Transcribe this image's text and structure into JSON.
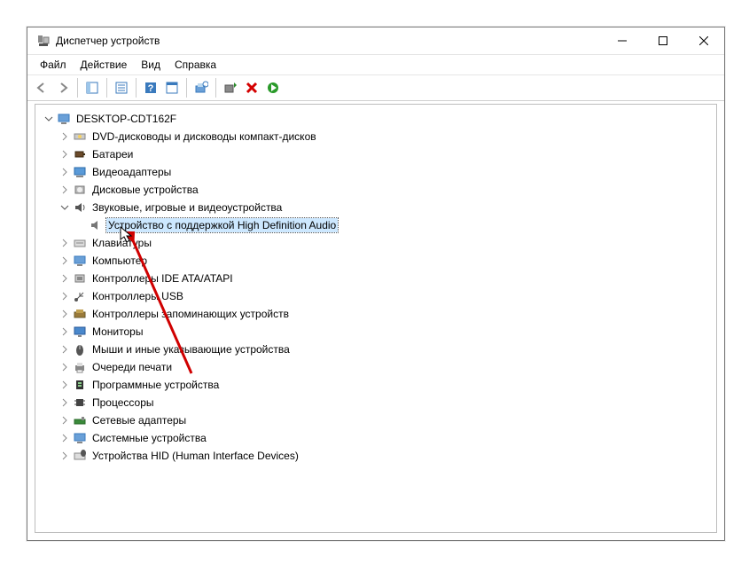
{
  "window": {
    "title": "Диспетчер устройств"
  },
  "menu": {
    "file": "Файл",
    "action": "Действие",
    "view": "Вид",
    "help": "Справка"
  },
  "tree": {
    "root": "DESKTOP-CDT162F",
    "items": [
      {
        "label": "DVD-дисководы и дисководы компакт-дисков"
      },
      {
        "label": "Батареи"
      },
      {
        "label": "Видеоадаптеры"
      },
      {
        "label": "Дисковые устройства"
      },
      {
        "label": "Звуковые, игровые и видеоустройства",
        "expanded": true,
        "child": "Устройство с поддержкой High Definition Audio"
      },
      {
        "label": "Клавиатуры"
      },
      {
        "label": "Компьютер"
      },
      {
        "label": "Контроллеры IDE ATA/ATAPI"
      },
      {
        "label": "Контроллеры USB"
      },
      {
        "label": "Контроллеры запоминающих устройств"
      },
      {
        "label": "Мониторы"
      },
      {
        "label": "Мыши и иные указывающие устройства"
      },
      {
        "label": "Очереди печати"
      },
      {
        "label": "Программные устройства"
      },
      {
        "label": "Процессоры"
      },
      {
        "label": "Сетевые адаптеры"
      },
      {
        "label": "Системные устройства"
      },
      {
        "label": "Устройства HID (Human Interface Devices)"
      }
    ]
  }
}
